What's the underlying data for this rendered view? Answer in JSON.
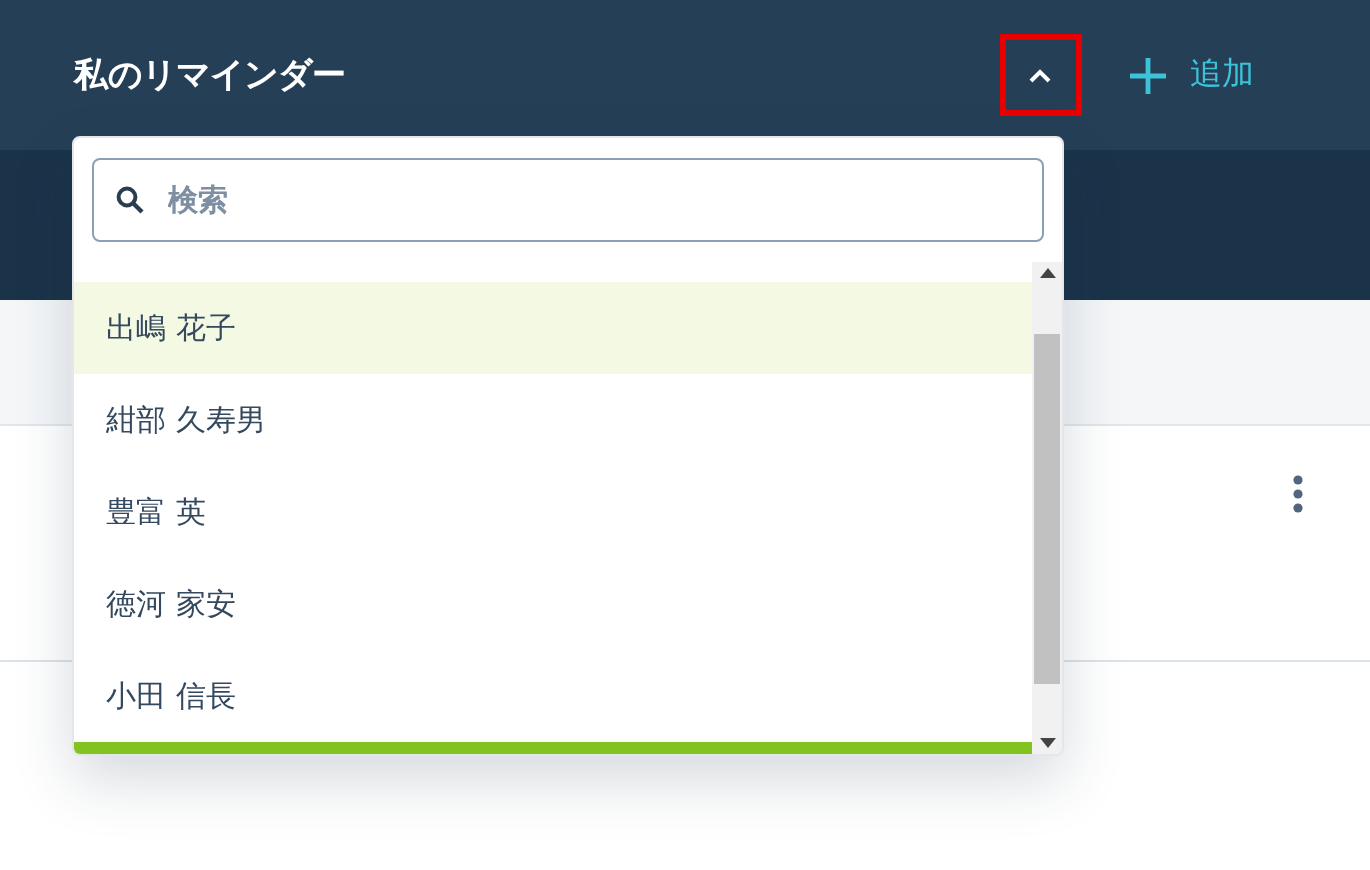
{
  "header": {
    "title": "私のリマインダー",
    "add_button": "追加",
    "toggle": {
      "expanded": true,
      "highlighted": true
    }
  },
  "dropdown": {
    "search": {
      "placeholder": "検索"
    },
    "items": [
      {
        "label": "出嶋 花子",
        "selected": true
      },
      {
        "label": "紺部 久寿男",
        "selected": false
      },
      {
        "label": "豊富 英",
        "selected": false
      },
      {
        "label": "徳河 家安",
        "selected": false
      },
      {
        "label": "小田 信長",
        "selected": false
      }
    ]
  }
}
